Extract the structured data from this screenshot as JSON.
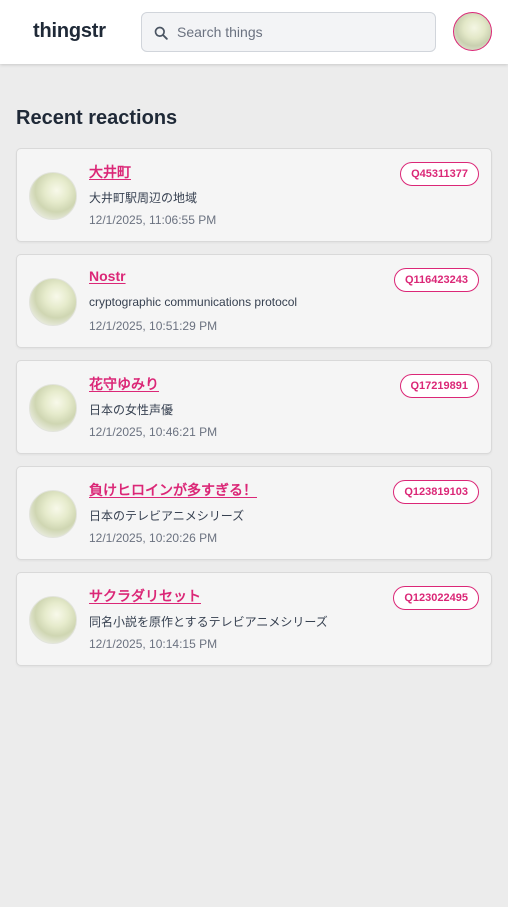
{
  "app": {
    "brand": "thingstr",
    "search_placeholder": "Search things"
  },
  "colors": {
    "accent": "#db2777",
    "background": "#ececec",
    "card": "#f5f5f5"
  },
  "icons": {
    "search": "search-icon",
    "avatar": "user-avatar"
  },
  "section": {
    "title": "Recent reactions"
  },
  "reactions": [
    {
      "title": "大井町",
      "id": "Q45311377",
      "description": "大井町駅周辺の地域",
      "time": "12/1/2025, 11:06:55 PM"
    },
    {
      "title": "Nostr",
      "id": "Q116423243",
      "description": "cryptographic communications protocol",
      "time": "12/1/2025, 10:51:29 PM"
    },
    {
      "title": "花守ゆみり",
      "id": "Q17219891",
      "description": "日本の女性声優",
      "time": "12/1/2025, 10:46:21 PM"
    },
    {
      "title": "負けヒロインが多すぎる！",
      "id": "Q123819103",
      "description": "日本のテレビアニメシリーズ",
      "time": "12/1/2025, 10:20:26 PM"
    },
    {
      "title": "サクラダリセット",
      "id": "Q123022495",
      "description": "同名小説を原作とするテレビアニメシリーズ",
      "time": "12/1/2025, 10:14:15 PM"
    }
  ]
}
